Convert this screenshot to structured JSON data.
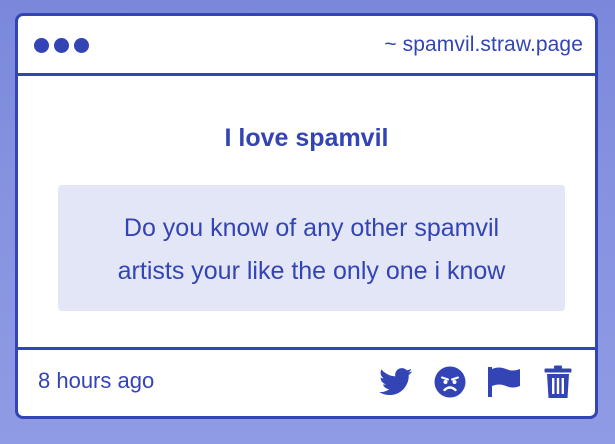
{
  "window": {
    "url": "~ spamvil.straw.page"
  },
  "post": {
    "title": "I love spamvil",
    "message_line1": "Do you know of any other spamvil",
    "message_line2": "artists your like the only one i know",
    "timestamp": "8 hours ago"
  },
  "actions": [
    {
      "icon": "twitter-icon"
    },
    {
      "icon": "angry-face-icon"
    },
    {
      "icon": "flag-icon"
    },
    {
      "icon": "trash-icon"
    }
  ],
  "colors": {
    "accent": "#3344b4",
    "message_background": "#e3e6f6",
    "page_background": "#8592e0"
  }
}
